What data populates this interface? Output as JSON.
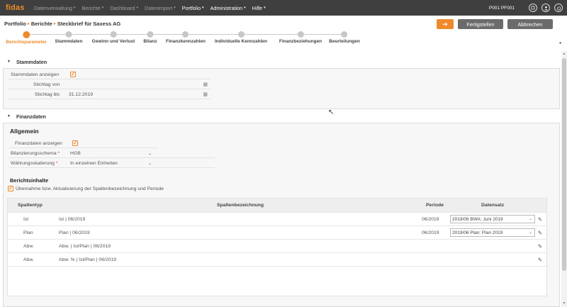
{
  "app": {
    "logo": "fidas",
    "user_code": "P001 PF001"
  },
  "menu": [
    {
      "label": "Datenverwaltung",
      "active": false
    },
    {
      "label": "Berichte",
      "active": false
    },
    {
      "label": "Dashboard",
      "active": false
    },
    {
      "label": "Datenimport",
      "active": false
    },
    {
      "label": "Portfolio",
      "active": true
    },
    {
      "label": "Administration",
      "active": true
    },
    {
      "label": "Hilfe",
      "active": true
    }
  ],
  "breadcrumb": {
    "items": [
      "Portfolio",
      "Berichte",
      "Steckbrief für Saxess AG"
    ],
    "sep": "▸"
  },
  "buttons": {
    "next": "➔",
    "finish": "Fertigstellen",
    "cancel": "Abbrechen"
  },
  "steps": [
    {
      "label": "Berichtsparameter",
      "active": true
    },
    {
      "label": "Stammdaten",
      "active": false
    },
    {
      "label": "Gewinn und Verlust",
      "active": false
    },
    {
      "label": "Bilanz",
      "active": false
    },
    {
      "label": "Finanzkennzahlen",
      "active": false
    },
    {
      "label": "Individuelle Kennzahlen",
      "active": false
    },
    {
      "label": "Finanzbeziehungen",
      "active": false
    },
    {
      "label": "Beurteilungen",
      "active": false
    }
  ],
  "stammdaten": {
    "title": "Stammdaten",
    "show_label": "Stammdaten anzeigen",
    "from_label": "Stichtag von",
    "from_value": "",
    "to_label": "Stichtag bis",
    "to_value": "31.12.2019"
  },
  "finanzdaten": {
    "title": "Finanzdaten",
    "allgemein": "Allgemein",
    "show_label": "Finanzdaten anzeigen",
    "schema_label": "Bilanzierungsschema",
    "schema_value": "HGB",
    "scale_label": "Währungsskalierung",
    "scale_value": "In einzelnen Einheiten",
    "required_mark": "*",
    "berichtsinhalte": "Berichtsinhalte",
    "apply_label": "Übernahme bzw. Aktualisierung der Spaltenbezeichnung und Periode"
  },
  "table": {
    "headers": {
      "type": "Spaltentyp",
      "name": "Spaltenbezeichnung",
      "period": "Periode",
      "dataset": "Datensatz"
    },
    "rows": [
      {
        "type": "Ist",
        "name": "Ist | 06/2019",
        "period": "06/2019",
        "dataset": "2019/06 BWA: Juni 2019"
      },
      {
        "type": "Plan",
        "name": "Plan | 06/2019",
        "period": "06/2019",
        "dataset": "2019/06 Plan: Plan 2019"
      },
      {
        "type": "Abw.",
        "name": "Abw. | Ist/Plan | 06/2019",
        "period": "",
        "dataset": ""
      },
      {
        "type": "Abw.",
        "name": "Abw. % | Ist/Plan | 06/2019",
        "period": "",
        "dataset": ""
      }
    ]
  },
  "icons": {
    "check": "✓",
    "calendar": "▦",
    "caret": "⌄",
    "pencil": "✎",
    "triangle": "▼",
    "save": "▪",
    "cursor": "↖",
    "scroll_up": "▲",
    "scroll_down": "▼",
    "menu_caret": "▾"
  },
  "colors": {
    "accent": "#ef8a2c",
    "topbar": "#3f3f3f",
    "button_grey": "#6b6b6b"
  }
}
